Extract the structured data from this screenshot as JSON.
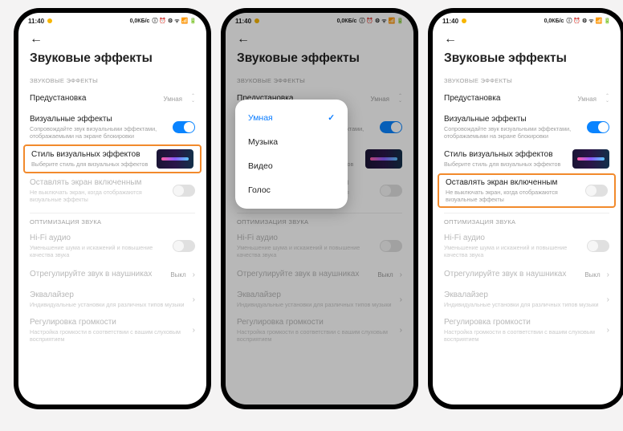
{
  "status": {
    "time": "11:40",
    "net": "0,0КБ/с"
  },
  "title": "Звуковые эффекты",
  "sec1": "ЗВУКОВЫЕ ЭФФЕКТЫ",
  "sec2": "ОПТИМИЗАЦИЯ ЗВУКА",
  "preset": {
    "label": "Предустановка",
    "value": "Умная"
  },
  "visual": {
    "t1": "Визуальные эффекты",
    "t2": "Сопровождайте звук визуальными эффектами, отображаемыми на экране блокировки"
  },
  "style": {
    "t1": "Стиль визуальных эффектов",
    "t2": "Выберите стиль для визуальных эффектов"
  },
  "keepon": {
    "t1": "Оставлять экран включенным",
    "t2": "Не выключать экран, когда отображаются визуальные эффекты"
  },
  "hifi": {
    "t1": "Hi-Fi аудио",
    "t2": "Уменьшение шума и искажений и повышение качества звука"
  },
  "headphones": {
    "t1": "Отрегулируйте звук в наушниках",
    "value": "Выкл"
  },
  "eq": {
    "t1": "Эквалайзер",
    "t2": "Индивидуальные установки для различных типов музыки"
  },
  "volume": {
    "t1": "Регулировка громкости",
    "t2": "Настройка громкости в соответствии с вашим слуховым восприятием"
  },
  "popup": {
    "o1": "Умная",
    "o2": "Музыка",
    "o3": "Видео",
    "o4": "Голос"
  }
}
